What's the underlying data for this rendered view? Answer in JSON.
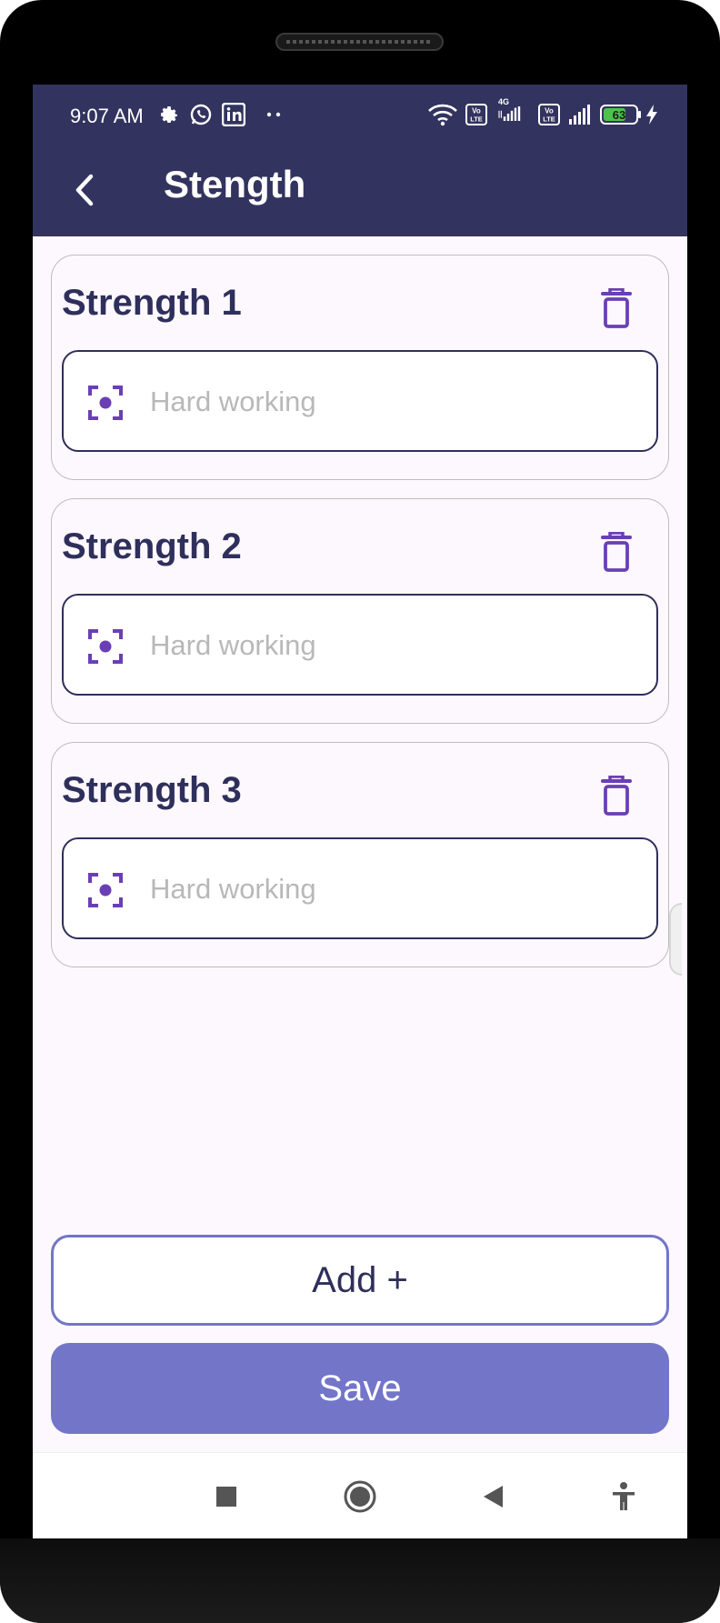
{
  "status_bar": {
    "time": "9:07 AM",
    "battery": "63",
    "network_4g": "4G",
    "volte_label": "Vo LTE",
    "icons": [
      "settings-icon",
      "whatsapp-icon",
      "linkedin-icon",
      "more-dots-icon",
      "wifi-icon",
      "volte-icon",
      "signal-icon",
      "battery-icon",
      "charging-icon"
    ]
  },
  "app_bar": {
    "title": "Stength",
    "back_icon": "chevron-left-icon"
  },
  "strengths": [
    {
      "title": "Strength 1",
      "placeholder": "Hard working",
      "value": ""
    },
    {
      "title": "Strength 2",
      "placeholder": "Hard working",
      "value": ""
    },
    {
      "title": "Strength 3",
      "placeholder": "Hard working",
      "value": ""
    }
  ],
  "actions": {
    "add_label": "Add +",
    "save_label": "Save"
  },
  "nav_bar": {
    "icons": [
      "recents-square-icon",
      "home-circle-icon",
      "back-triangle-icon",
      "accessibility-icon"
    ]
  },
  "colors": {
    "header": "#333360",
    "accent": "#7275c8",
    "icon_purple": "#6a3fb5",
    "title_text": "#2f2f5c",
    "background": "#fdf8fd"
  }
}
